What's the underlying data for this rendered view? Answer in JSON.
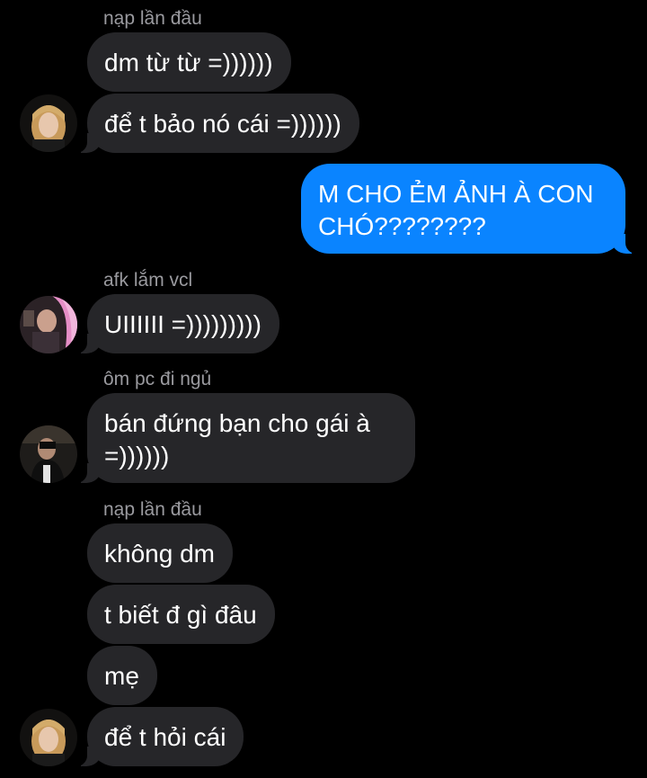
{
  "colors": {
    "background": "#000000",
    "incoming_bubble": "#262629",
    "outgoing_bubble": "#0a84ff",
    "sender_name": "#9a9a9f",
    "message_text": "#ffffff"
  },
  "thread": {
    "groups": [
      {
        "sender": "nạp lần đầu",
        "avatar": "avatar-girl-blonde",
        "messages": [
          "dm từ từ =))))))",
          "để t bảo nó cái =))))))"
        ]
      },
      {
        "sender": "",
        "outgoing": true,
        "messages": [
          "M CHO ẺM ẢNH À CON CHÓ????????"
        ]
      },
      {
        "sender": "afk lắm vcl",
        "avatar": "avatar-girl-pink",
        "messages": [
          "UIIIIII =)))))))))"
        ]
      },
      {
        "sender": "ôm pc đi ngủ",
        "avatar": "avatar-person-phone",
        "messages": [
          "bán đứng bạn cho gái à =))))))"
        ]
      },
      {
        "sender": "nạp lần đầu",
        "avatar": "avatar-girl-blonde",
        "messages": [
          "không dm",
          "t biết đ gì đâu",
          "mẹ",
          "để t hỏi cái"
        ]
      }
    ]
  }
}
